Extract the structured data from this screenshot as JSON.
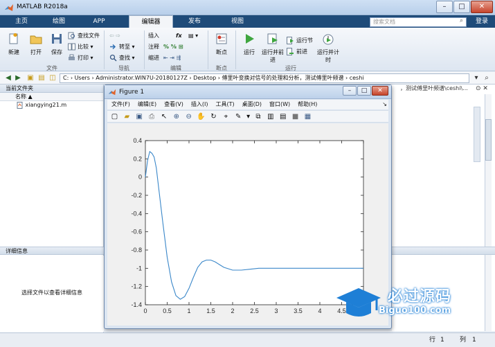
{
  "window": {
    "title": "MATLAB R2018a",
    "min": "–",
    "max": "□",
    "close": "✕"
  },
  "tabs": [
    {
      "label": "主页"
    },
    {
      "label": "绘图"
    },
    {
      "label": "APP"
    },
    {
      "label": "编辑器",
      "active": true
    },
    {
      "label": "发布"
    },
    {
      "label": "视图"
    }
  ],
  "search": {
    "placeholder": "搜索文档"
  },
  "login_label": "登录",
  "ribbon": {
    "file": {
      "label": "文件",
      "new": "新建",
      "open": "打开",
      "save": "保存",
      "find_files": "查找文件",
      "compare": "比较",
      "print": "打印"
    },
    "nav": {
      "label": "导航",
      "goto": "转至",
      "find": "查找"
    },
    "edit": {
      "label": "编辑",
      "insert": "插入",
      "comment": "注释",
      "indent": "缩进",
      "fx": "fx"
    },
    "breakpoints": {
      "label": "断点",
      "breakpoint": "断点"
    },
    "run": {
      "label": "运行",
      "run": "运行",
      "run_advance": "运行并前进",
      "run_section": "运行节",
      "advance": "前进",
      "run_time": "运行并计时"
    }
  },
  "address": {
    "path": "C: › Users › Administrator.WIN7U-20180127Z › Desktop › 傅里叶变换对信号的处理和分析，测试傅里叶频谱 › ceshi",
    "behind_path": "，测试傅里叶频谱\\ceshi\\..."
  },
  "current_folder": {
    "title": "当前文件夹",
    "column_name": "名称 ▲",
    "files": [
      {
        "name": "xiangying21.m"
      }
    ]
  },
  "details": {
    "title": "详细信息",
    "hint": "选择文件以查看详细信息"
  },
  "status": {
    "row_label": "行",
    "row": "1",
    "col_label": "列",
    "col": "1"
  },
  "figure": {
    "title": "Figure 1",
    "menus": [
      "文件(F)",
      "编辑(E)",
      "查看(V)",
      "插入(I)",
      "工具(T)",
      "桌面(D)",
      "窗口(W)",
      "帮助(H)"
    ]
  },
  "watermark": {
    "line1": "必过源码",
    "line2": "Biguo100.com"
  },
  "colors": {
    "tabbar": "#1f4b79",
    "line": "#3a87c9"
  },
  "chart_data": {
    "type": "line",
    "title": "",
    "xlabel": "",
    "ylabel": "",
    "xlim": [
      0,
      5
    ],
    "ylim": [
      -1.4,
      0.4
    ],
    "xticks": [
      "0",
      "0.5",
      "1",
      "1.5",
      "2",
      "2.5",
      "3",
      "3.5",
      "4",
      "4.5",
      "5"
    ],
    "yticks": [
      "0.4",
      "0.2",
      "0",
      "-0.2",
      "-0.4",
      "-0.6",
      "-0.8",
      "-1",
      "-1.2",
      "-1.4"
    ],
    "grid": false,
    "series": [
      {
        "x": [
          0,
          0.05,
          0.1,
          0.15,
          0.2,
          0.25,
          0.3,
          0.4,
          0.5,
          0.6,
          0.7,
          0.8,
          0.9,
          1.0,
          1.1,
          1.2,
          1.3,
          1.4,
          1.5,
          1.6,
          1.7,
          1.8,
          2.0,
          2.2,
          2.4,
          2.6,
          2.8,
          3.0,
          3.5,
          4.0,
          4.5,
          5.0
        ],
        "y": [
          0,
          0.18,
          0.28,
          0.26,
          0.22,
          0.1,
          -0.1,
          -0.5,
          -0.88,
          -1.15,
          -1.3,
          -1.34,
          -1.31,
          -1.22,
          -1.1,
          -0.99,
          -0.93,
          -0.91,
          -0.91,
          -0.93,
          -0.96,
          -0.99,
          -1.02,
          -1.02,
          -1.01,
          -1.0,
          -1.0,
          -1.0,
          -1.0,
          -1.0,
          -1.0,
          -1.0
        ]
      }
    ]
  }
}
